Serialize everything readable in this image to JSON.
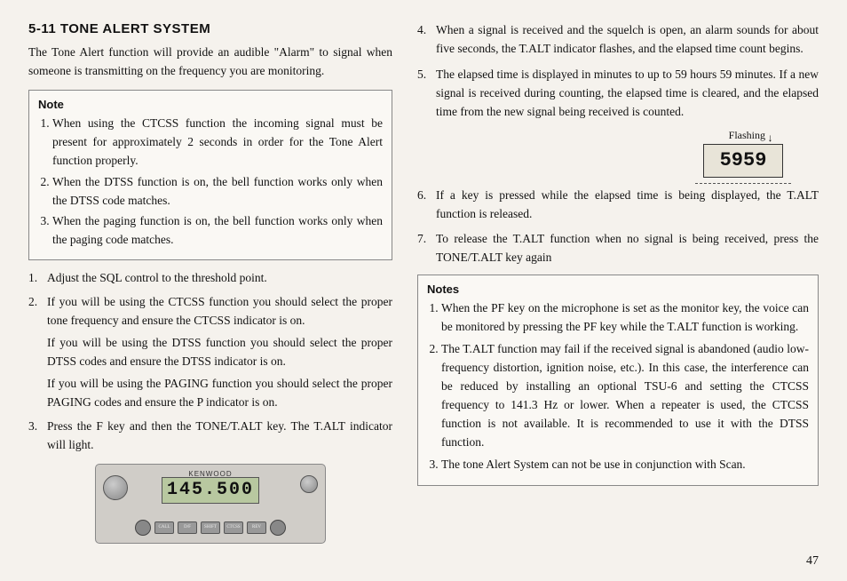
{
  "page": {
    "title": "5-11 TONE ALERT SYSTEM",
    "page_number": "47"
  },
  "left_col": {
    "intro": "The Tone Alert function will provide an audible \"Alarm\" to signal when someone is transmitting on the frequency you are monitoring.",
    "note_box": {
      "title": "Note",
      "items": [
        "When using the CTCSS function the incoming signal must be present for approximately 2 seconds in order for the Tone Alert function properly.",
        "When the DTSS function is on, the bell function works only when the DTSS code matches.",
        "When the paging function is on, the bell function works only when the paging code matches."
      ]
    },
    "steps": [
      {
        "num": "1.",
        "text": "Adjust the SQL control to the threshold point."
      },
      {
        "num": "2.",
        "text": "If you will be using the CTCSS function you should select the proper tone frequency and ensure the CTCSS indicator is on.",
        "sub1": "If you will be using the DTSS function you should select the proper DTSS codes and ensure the DTSS indicator is on.",
        "sub2": "If you will be using the PAGING function you should select the proper PAGING codes and ensure the P indicator is on."
      },
      {
        "num": "3.",
        "text": "Press the F key and then the TONE/T.ALT key. The T.ALT indicator will light."
      }
    ],
    "radio": {
      "brand": "KENWOOD",
      "display": "145.500"
    }
  },
  "right_col": {
    "steps": [
      {
        "num": "4.",
        "text": "When a signal is received and the squelch is open, an alarm sounds for about five seconds, the T.ALT indicator flashes, and the elapsed time count begins."
      },
      {
        "num": "5.",
        "text": "The elapsed time is displayed in minutes to up to 59 hours 59 minutes. If a new signal is received during counting, the elapsed time is cleared, and the elapsed time from the new signal being received is counted."
      }
    ],
    "diagram": {
      "flashing_label": "Flashing",
      "display_value": "5959"
    },
    "steps2": [
      {
        "num": "6.",
        "text": "If a key is pressed while the elapsed time is being displayed, the T.ALT function is released."
      },
      {
        "num": "7.",
        "text": "To release the T.ALT function when no signal is being received, press the TONE/T.ALT key again"
      }
    ],
    "notes_box": {
      "title": "Notes",
      "items": [
        "When the PF key on the microphone is set as the monitor key, the voice can be monitored by pressing the PF key while the T.ALT function is working.",
        "The T.ALT function may fail if the received signal is abandoned (audio low-frequency distortion, ignition noise, etc.). In this case, the interference can be reduced by installing an optional TSU-6 and setting the CTCSS frequency to 141.3 Hz or lower. When a repeater is used, the CTCSS function is not available. It is recommended to use it with the DTSS function.",
        "The tone Alert System can not be use in conjunction with Scan."
      ]
    }
  }
}
